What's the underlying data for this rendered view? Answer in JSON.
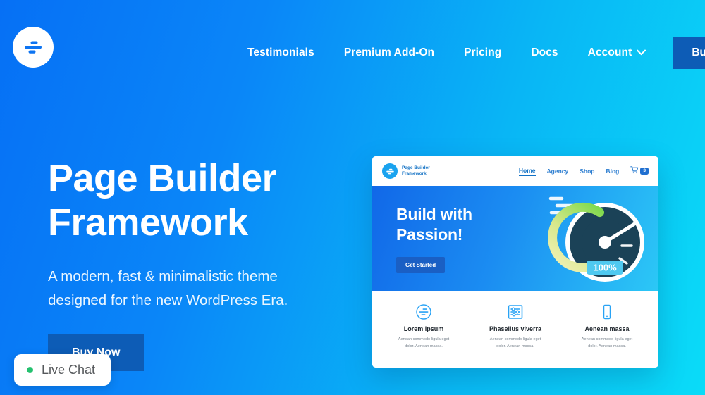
{
  "site": {
    "logo_icon": "page-builder-framework-logo-icon",
    "brand_accent": "#0D5CB6",
    "background_from": "#0670F5",
    "background_to": "#0ADCF8"
  },
  "topnav": {
    "items": [
      {
        "label": "Testimonials"
      },
      {
        "label": "Premium Add-On"
      },
      {
        "label": "Pricing"
      },
      {
        "label": "Docs"
      },
      {
        "label": "Account",
        "has_dropdown": true,
        "chevron": "∨"
      }
    ],
    "cta_label": "Buy Now"
  },
  "hero": {
    "title_line1": "Page Builder",
    "title_line2": "Framework",
    "subtitle_line1": "A modern, fast & minimalistic theme",
    "subtitle_line2": "designed for the new WordPress Era.",
    "cta_label": "Buy Now"
  },
  "live_chat": {
    "label": "Live Chat",
    "status_color": "#25C16F"
  },
  "mockup": {
    "nav": {
      "logo_text_line1": "Page Builder",
      "logo_text_line2": "Framework",
      "links": [
        {
          "label": "Home",
          "active": true
        },
        {
          "label": "Agency",
          "active": false
        },
        {
          "label": "Shop",
          "active": false
        },
        {
          "label": "Blog",
          "active": false
        }
      ],
      "cart_icon": "shopping-cart-icon",
      "cart_count": "3"
    },
    "hero": {
      "title_line1": "Build with",
      "title_line2": "Passion!",
      "cta_label": "Get Started",
      "gauge": {
        "icon": "speedometer-gauge-icon",
        "value_label": "100%"
      }
    },
    "cards": [
      {
        "icon": "circle-lines-icon",
        "title": "Lorem Ipsum",
        "body_line1": "Aenean commodo ligula eget",
        "body_line2": "dolor. Aenean massa."
      },
      {
        "icon": "sliders-settings-icon",
        "title": "Phasellus viverra",
        "body_line1": "Aenean commodo ligula eget",
        "body_line2": "dolor. Aenean massa."
      },
      {
        "icon": "mobile-phone-icon",
        "title": "Aenean massa",
        "body_line1": "Aenean commodo ligula eget",
        "body_line2": "dolor. Aenean massa."
      }
    ]
  }
}
